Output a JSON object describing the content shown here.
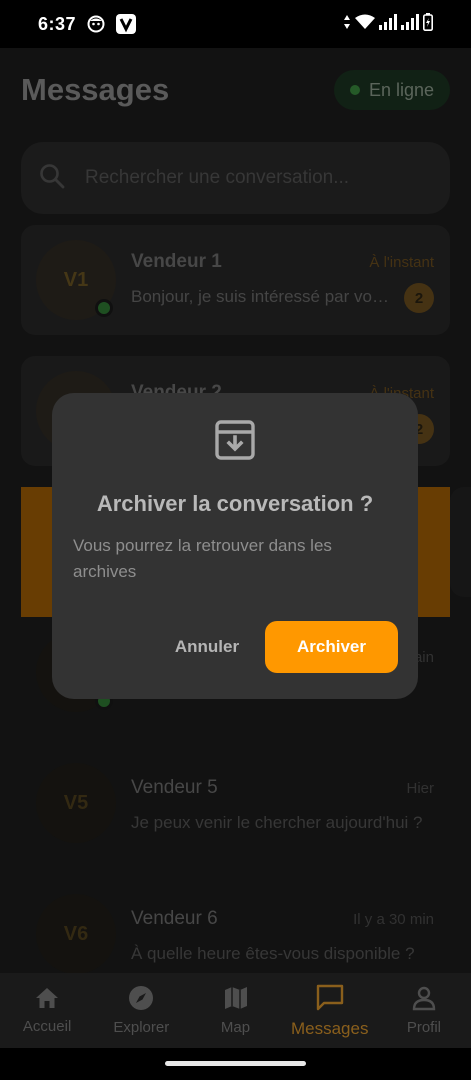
{
  "status_bar": {
    "time": "6:37"
  },
  "header": {
    "title": "Messages",
    "online_label": "En ligne"
  },
  "search": {
    "placeholder": "Rechercher une conversation..."
  },
  "conversations": [
    {
      "avatar": "V1",
      "name": "Vendeur 1",
      "time": "À l'instant",
      "message": "Bonjour, je suis intéressé par votre article",
      "unread": "2"
    },
    {
      "name": "Vendeur 2",
      "time": "À l'instant",
      "unread": "2"
    },
    {
      "time": "ain"
    },
    {
      "avatar": "V5",
      "name": "Vendeur 5",
      "time": "Hier",
      "message": "Je peux venir le chercher aujourd'hui ?"
    },
    {
      "avatar": "V6",
      "name": "Vendeur 6",
      "time": "Il y a 30 min",
      "message": "À quelle heure êtes-vous disponible ?"
    }
  ],
  "dialog": {
    "title": "Archiver la conversation ?",
    "body": "Vous pourrez la retrouver dans les archives",
    "cancel_label": "Annuler",
    "confirm_label": "Archiver"
  },
  "bottom_nav": [
    {
      "label": "Accueil",
      "icon": "home-icon"
    },
    {
      "label": "Explorer",
      "icon": "compass-icon"
    },
    {
      "label": "Map",
      "icon": "map-icon"
    },
    {
      "label": "Messages",
      "icon": "chat-icon",
      "active": true
    },
    {
      "label": "Profil",
      "icon": "person-icon"
    }
  ],
  "colors": {
    "accent": "#ff9800",
    "online": "#3a8a3e",
    "dialog_bg": "#333333"
  }
}
